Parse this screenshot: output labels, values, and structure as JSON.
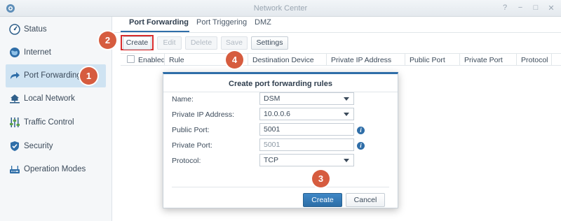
{
  "window": {
    "title": "Network Center",
    "controls": [
      "?",
      "−",
      "□",
      "✕"
    ]
  },
  "sidebar": {
    "items": [
      {
        "label": "Status",
        "icon": "gauge-icon",
        "active": false
      },
      {
        "label": "Internet",
        "icon": "globe-icon",
        "active": false
      },
      {
        "label": "Port Forwarding",
        "icon": "arrow-forward-icon",
        "active": true
      },
      {
        "label": "Local Network",
        "icon": "home-network-icon",
        "active": false
      },
      {
        "label": "Traffic Control",
        "icon": "sliders-icon",
        "active": false
      },
      {
        "label": "Security",
        "icon": "shield-icon",
        "active": false
      },
      {
        "label": "Operation Modes",
        "icon": "router-icon",
        "active": false
      }
    ]
  },
  "tabs": [
    {
      "label": "Port Forwarding",
      "active": true
    },
    {
      "label": "Port Triggering",
      "active": false
    },
    {
      "label": "DMZ",
      "active": false
    }
  ],
  "toolbar": {
    "create": "Create",
    "edit": "Edit",
    "delete": "Delete",
    "save": "Save",
    "settings": "Settings"
  },
  "table": {
    "columns": [
      "Enabled",
      "Rule",
      "Destination Device",
      "Private IP Address",
      "Public Port",
      "Private Port",
      "Protocol"
    ]
  },
  "dialog": {
    "title": "Create port forwarding rules",
    "fields": {
      "name": {
        "label": "Name:",
        "value": "DSM"
      },
      "private_ip": {
        "label": "Private IP Address:",
        "value": "10.0.0.6"
      },
      "public_port": {
        "label": "Public Port:",
        "value": "5001"
      },
      "private_port": {
        "label": "Private Port:",
        "placeholder": "5001"
      },
      "protocol": {
        "label": "Protocol:",
        "value": "TCP"
      }
    },
    "create_label": "Create",
    "cancel_label": "Cancel"
  },
  "annotations": {
    "step1": "1",
    "step2": "2",
    "step3": "3",
    "step4": "4"
  },
  "colors": {
    "accent": "#2f6ea8",
    "badge": "#d65c3f",
    "highlight": "#d82c2c",
    "active_nav": "#cfe3f2"
  }
}
